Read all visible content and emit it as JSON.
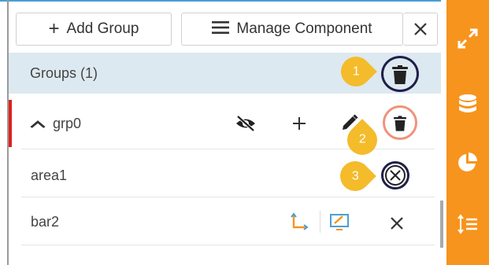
{
  "toolbar": {
    "add_group_label": "Add Group",
    "add_group_icon": "plus-icon",
    "manage_label": "Manage Component",
    "manage_icon": "hamburger-menu-icon",
    "close_icon": "close-icon"
  },
  "groups_header": {
    "label": "Groups (1)",
    "delete_icon": "trash-icon"
  },
  "group": {
    "name": "grp0",
    "expanded": true,
    "actions": [
      "eye-slash-icon",
      "plus-icon",
      "pencil-icon",
      "trash-icon"
    ]
  },
  "components": [
    {
      "name": "area1",
      "actions": [
        "remove-circle-icon"
      ]
    },
    {
      "name": "bar2",
      "actions": [
        "axis-icon",
        "monitor-edit-icon",
        "close-icon"
      ]
    }
  ],
  "callouts": [
    {
      "number": "1"
    },
    {
      "number": "2"
    },
    {
      "number": "3"
    }
  ],
  "sidebar": {
    "items": [
      "expand-icon",
      "database-icon",
      "pie-chart-icon",
      "sort-lines-icon"
    ]
  },
  "colors": {
    "sidebar_bg": "#f7941d",
    "header_bg": "#dde9f0",
    "callout": "#f4bb2b",
    "accent_red": "#e02020",
    "ring_dark": "#1f1f4a",
    "ring_salmon": "#f0937a"
  }
}
